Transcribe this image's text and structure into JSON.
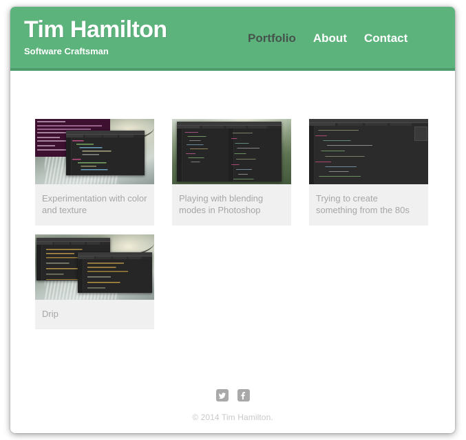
{
  "header": {
    "site_title": "Tim Hamilton",
    "tagline": "Software Craftsman",
    "brand_color": "#5cb37c",
    "brand_border_color": "#4e9c6b",
    "nav": [
      {
        "label": "Portfolio",
        "active": true,
        "color": "#45534c"
      },
      {
        "label": "About",
        "active": false,
        "color": "#ffffff"
      },
      {
        "label": "Contact",
        "active": false,
        "color": "#ffffff"
      }
    ]
  },
  "main": {
    "portfolio_items": [
      {
        "caption": "Experimentation with color and texture",
        "thumb_alt": "code-editor-over-waterfall-photo"
      },
      {
        "caption": "Playing with blending modes in Photoshop",
        "thumb_alt": "split-pane-code-editor-over-jungle-photo"
      },
      {
        "caption": "Trying to create something from the 80s",
        "thumb_alt": "dark-code-editor-with-tabs"
      },
      {
        "caption": "Drip",
        "thumb_alt": "two-code-editor-windows-over-waterfall-photo"
      }
    ],
    "caption_bg": "#f0f0f0",
    "caption_color": "#a6a6a6"
  },
  "footer": {
    "social": [
      {
        "name": "twitter",
        "label": "Twitter"
      },
      {
        "name": "facebook",
        "label": "Facebook"
      }
    ],
    "copyright": "© 2014 Tim Hamilton.",
    "social_bg": "#a9a9a9",
    "copyright_color": "#c9c9c9"
  }
}
